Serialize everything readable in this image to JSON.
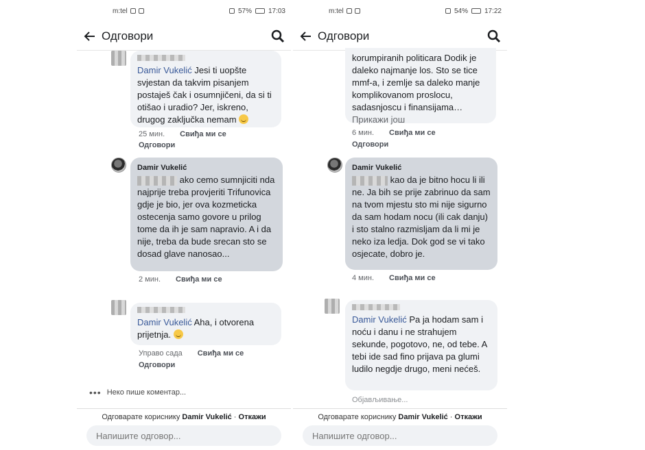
{
  "left": {
    "status": {
      "carrier": "m:tel",
      "battery": "57%",
      "time": "17:03"
    },
    "title": "Одговори",
    "comments": [
      {
        "mention": "Damir Vukelić",
        "text": "Jesi ti uopšte svjestan da takvim pisanjem postaješ čak i osumnjičeni, da si ti otišao i uradio? Jer, iskreno, drugog zaključka nemam",
        "time": "25 мин.",
        "like": "Свиђа ми се",
        "reply": "Одговори"
      },
      {
        "author": "Damir Vukelić",
        "text": "ako cemo sumnjiciti nda najprije treba provjeriti Trifunovica gdje je bio, jer ova kozmeticka ostecenja samo govore u prilog tome da ih je sam napravio. A i da nije, treba da bude srecan sto se dosad glave nanosao...",
        "time": "2 мин.",
        "like": "Свиђа ми се"
      },
      {
        "mention": "Damir Vukelić",
        "text": "Aha, i otvorena prijetnja.",
        "time": "Управо сада",
        "like": "Свиђа ми се",
        "reply": "Одговори"
      }
    ],
    "typing": "Неко пише коментар...",
    "replying_prefix": "Одговарате кориснику",
    "replying_name": "Damir Vukelić",
    "cancel": "Откажи",
    "input_placeholder": "Напишите одговор..."
  },
  "right": {
    "status": {
      "carrier": "m:tel",
      "battery": "54%",
      "time": "17:22"
    },
    "title": "Одговори",
    "comments": [
      {
        "text": "korumpiranih politicara Dodik je daleko najmanje los. Sto se tice mmf-a, i zemlje sa daleko manje komplikovanom proslocu, sadasnjoscu i finansijama…",
        "more": "Прикажи још",
        "time": "6 мин.",
        "like": "Свиђа ми се",
        "reply": "Одговори"
      },
      {
        "author": "Damir Vukelić",
        "text": "kao da je bitno hocu li ili ne. Ja bih se prije zabrinuo da sam na tvom mjestu sto mi nije sigurno da sam hodam nocu (ili cak danju) i sto stalno razmisljam da li mi je neko iza ledja. Dok god se vi tako osjecate, dobro je.",
        "time": "4 мин.",
        "like": "Свиђа ми се"
      },
      {
        "mention": "Damir Vukelić",
        "text": "Pa ja hodam sam i noću i danu i ne strahujem sekunde, pogotovo, ne, od tebe. A tebi ide sad fino prijava pa glumi ludilo negdje drugo, meni nećeš.",
        "posting": "Објављивање..."
      }
    ],
    "replying_prefix": "Одговарате кориснику",
    "replying_name": "Damir Vukelić",
    "cancel": "Откажи",
    "input_placeholder": "Напишите одговор..."
  }
}
